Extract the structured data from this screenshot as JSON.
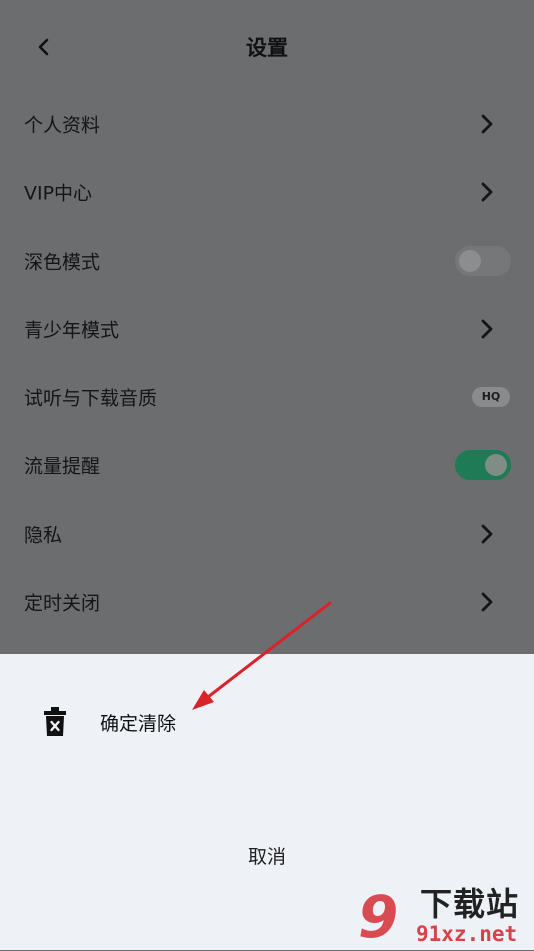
{
  "header": {
    "title": "设置",
    "back_icon": "chevron-left-icon"
  },
  "settings": [
    {
      "label": "个人资料",
      "control": "chevron"
    },
    {
      "label": "VIP中心",
      "control": "chevron"
    },
    {
      "label": "深色模式",
      "control": "toggle",
      "toggle_on": false
    },
    {
      "label": "青少年模式",
      "control": "chevron"
    },
    {
      "label": "试听与下载音质",
      "control": "badge",
      "badge": "HQ"
    },
    {
      "label": "流量提醒",
      "control": "toggle",
      "toggle_on": true
    },
    {
      "label": "隐私",
      "control": "chevron"
    },
    {
      "label": "定时关闭",
      "control": "chevron"
    }
  ],
  "sheet": {
    "confirm_label": "确定清除",
    "confirm_icon": "trash-icon",
    "cancel_label": "取消"
  },
  "watermark": {
    "mark": "9",
    "text": "下载站",
    "url": "91xz.net"
  },
  "colors": {
    "overlay": "#6c6d6f",
    "sheet": "#eef2f6",
    "toggle_on": "#1f7a56",
    "annotation": "#d9222a",
    "watermark": "#d8434b"
  }
}
